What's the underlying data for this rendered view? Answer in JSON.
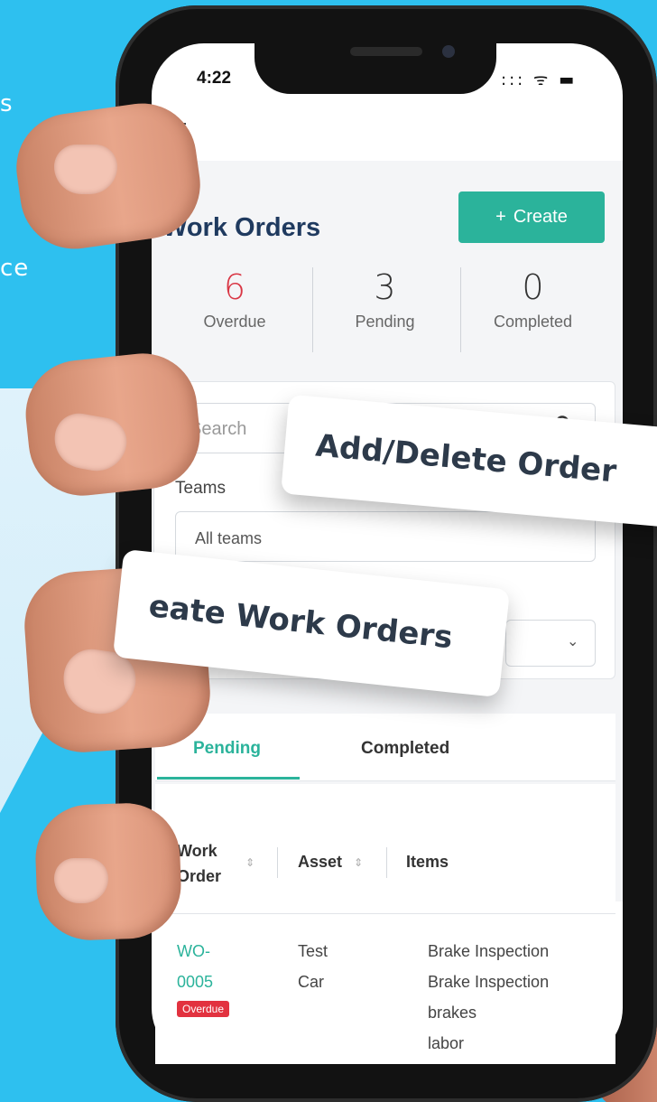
{
  "background": {
    "line1": "s",
    "line2": "ce"
  },
  "status_bar": {
    "time": "4:22",
    "icons": "::: ᯤ ▬"
  },
  "header": {
    "menu_icon": "hamburger-icon"
  },
  "page": {
    "title": "Work Orders",
    "create_label": "Create",
    "create_icon": "+"
  },
  "stats": [
    {
      "value": "6",
      "label": "Overdue"
    },
    {
      "value": "3",
      "label": "Pending"
    },
    {
      "value": "0",
      "label": "Completed"
    }
  ],
  "filters": {
    "search_placeholder": "Search",
    "teams_label": "Teams",
    "teams_value": "All teams"
  },
  "tabs": [
    {
      "label": "Pending",
      "active": true
    },
    {
      "label": "Completed",
      "active": false
    }
  ],
  "table": {
    "columns": [
      "Work Order",
      "Asset",
      "Items"
    ],
    "rows": [
      {
        "work_order": "WO-0005",
        "asset": "Test Car",
        "items": [
          "Brake Inspection",
          "Brake Inspection",
          "brakes",
          "labor"
        ],
        "badge": "Overdue"
      }
    ]
  },
  "callouts": {
    "top": "Add/Delete Order",
    "bottom": "eate Work Orders"
  },
  "colors": {
    "background": "#2ec0ef",
    "accent": "#2bb39b",
    "title": "#1f3a5f",
    "danger": "#d93644"
  }
}
